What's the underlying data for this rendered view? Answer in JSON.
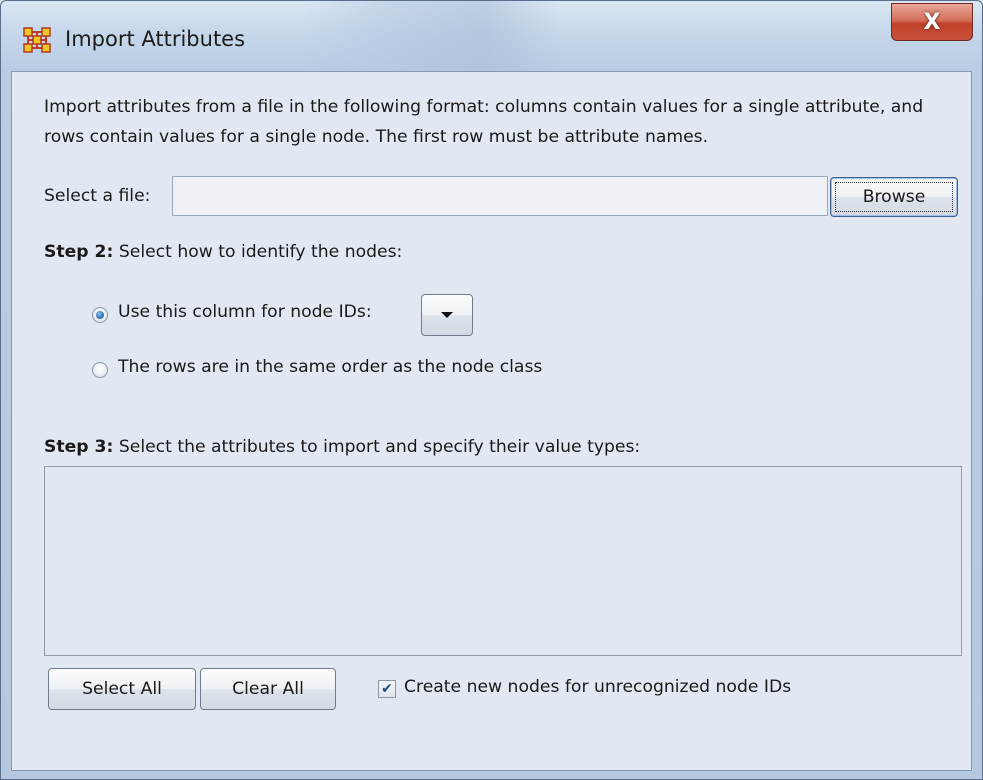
{
  "window": {
    "title": "Import Attributes",
    "close_glyph": "X",
    "app_icon": "network-graph-icon",
    "accent_color": "#2a6fb5",
    "close_color": "#c0412a"
  },
  "description": "Import attributes from a file in the following format: columns contain values for a single attribute, and rows contain values for a single node. The first row must be attribute names.",
  "file": {
    "label": "Select a file:",
    "value": "",
    "browse_label": "Browse"
  },
  "step2": {
    "prefix": "Step 2:",
    "text": " Select how to identify the nodes:",
    "option_column_label": "Use this column for node IDs:",
    "option_column_checked": true,
    "column_selected_value": "",
    "option_order_label": "The rows are in the same order as the node class",
    "option_order_checked": false
  },
  "step3": {
    "prefix": "Step 3:",
    "text": " Select the attributes to import and specify their value types:",
    "attributes": []
  },
  "buttons": {
    "select_all": "Select All",
    "clear_all": "Clear All"
  },
  "create_nodes": {
    "label": "Create new nodes for unrecognized node IDs",
    "checked": true,
    "check_glyph": "✔"
  }
}
